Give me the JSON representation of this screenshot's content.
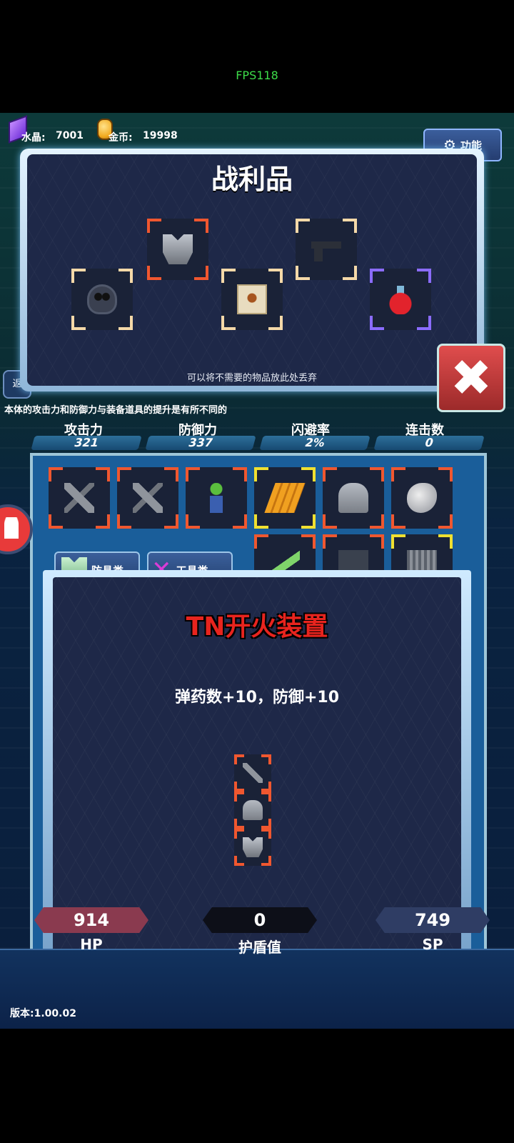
{
  "fps": "FPS118",
  "resources": {
    "crystal_label": "水晶:",
    "crystal_value": "7001",
    "gold_label": "金币:",
    "gold_value": "19998"
  },
  "func_button": {
    "label": "功能",
    "icon": "gear-icon"
  },
  "loot": {
    "title": "战利品",
    "tip": "可以将不需要的物品放此处丢弃",
    "items": [
      {
        "icon": "gas-mask-icon",
        "rarity": "white"
      },
      {
        "icon": "chest-armor-icon",
        "rarity": "orange"
      },
      {
        "icon": "scroll-map-icon",
        "rarity": "white"
      },
      {
        "icon": "pistol-icon",
        "rarity": "white"
      },
      {
        "icon": "red-potion-icon",
        "rarity": "purple"
      }
    ]
  },
  "side_tab": "返",
  "hint": "本体的攻击力和防御力与装备道具的提升是有所不同的",
  "stats": [
    {
      "label": "攻击力",
      "value": "321"
    },
    {
      "label": "防御力",
      "value": "337"
    },
    {
      "label": "闪避率",
      "value": "2%"
    },
    {
      "label": "连击数",
      "value": "0"
    }
  ],
  "inventory_row1": [
    {
      "icon": "firing-device-icon",
      "rarity": "orange"
    },
    {
      "icon": "firing-device-icon",
      "rarity": "orange"
    },
    {
      "icon": "zombie-figure-icon",
      "rarity": "orange"
    },
    {
      "icon": "bullets-icon",
      "rarity": "yellow"
    },
    {
      "icon": "helmet-icon",
      "rarity": "orange"
    },
    {
      "icon": "ore-rock-icon",
      "rarity": "orange"
    }
  ],
  "inventory_row2": [
    {
      "icon": "unknown-item-icon",
      "rarity": "orange"
    },
    {
      "icon": "unknown-item-icon",
      "rarity": "orange"
    },
    {
      "icon": "unknown-item-icon",
      "rarity": "orange"
    },
    {
      "icon": "syringe-icon",
      "rarity": "orange"
    },
    {
      "icon": "toolbox-icon",
      "rarity": "orange"
    },
    {
      "icon": "chain-icon",
      "rarity": "yellow"
    }
  ],
  "tabs": [
    {
      "label": "防具类",
      "icon": "armor-icon"
    },
    {
      "label": "工具类",
      "icon": "wrench-icon"
    }
  ],
  "detail": {
    "name": "TN开火装置",
    "desc": "弹药数+10，防御+10",
    "components": [
      "firing-device-icon",
      "helmet-icon",
      "chest-armor-icon"
    ]
  },
  "vitals": [
    {
      "value": "914",
      "label": "HP"
    },
    {
      "value": "0",
      "label": "护盾值"
    },
    {
      "value": "749",
      "label": "SP"
    }
  ],
  "version": "版本:1.00.02",
  "colors": {
    "orange": "#f0572f",
    "white": "#f5d9a8",
    "purple": "#8b6cff",
    "yellow": "#f0e030",
    "hp_bar": "#8a3a4f",
    "shield_bar": "#0d0f18",
    "sp_bar": "#2f3d64"
  }
}
